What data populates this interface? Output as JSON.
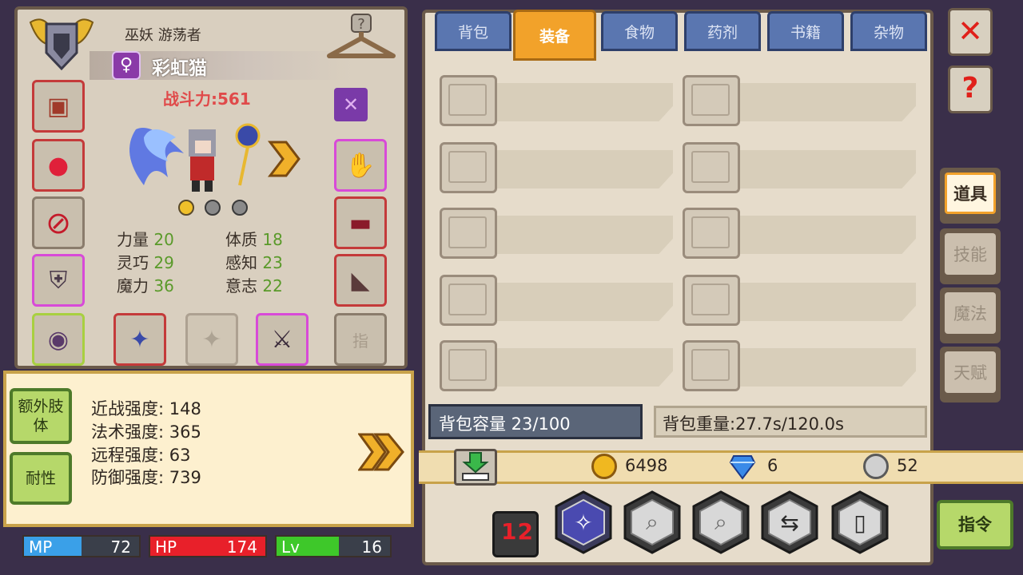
{
  "character": {
    "class_line": "巫妖 游荡者",
    "name": "彩虹猫",
    "gender_symbol": "♀",
    "power": "战斗力:561",
    "stats": [
      {
        "label": "力量",
        "value": "20"
      },
      {
        "label": "体质",
        "value": "18"
      },
      {
        "label": "灵巧",
        "value": "29"
      },
      {
        "label": "感知",
        "value": "23"
      },
      {
        "label": "魔力",
        "value": "36"
      },
      {
        "label": "意志",
        "value": "22"
      }
    ],
    "finger_slot_label": "指"
  },
  "info_panel": {
    "btn_extra_limbs": "额外肢体",
    "btn_resistance": "耐性",
    "lines": [
      "近战强度: 148",
      "法术强度: 365",
      "远程强度: 63",
      "防御强度: 739"
    ]
  },
  "bars": {
    "mp_label": "MP",
    "mp": "72",
    "hp_label": "HP",
    "hp": "174",
    "lv_label": "Lv",
    "lv": "16",
    "mp_fill": 0.5,
    "hp_fill": 1.0,
    "lv_fill": 0.55
  },
  "tabs": [
    "背包",
    "装备",
    "食物",
    "药剂",
    "书籍",
    "杂物"
  ],
  "active_tab": "装备",
  "inventory": {
    "capacity": "背包容量 23/100",
    "weight": "背包重量:27.7s/120.0s"
  },
  "currency": {
    "gold": "6498",
    "gems": "6",
    "silver": "52"
  },
  "side_tabs": [
    "道具",
    "技能",
    "魔法",
    "天赋"
  ],
  "active_side_tab": "道具",
  "command_label": "指令",
  "page_indicator": "12",
  "colors": {
    "active_tab": "#f2a22a",
    "tab": "#5a76b0",
    "mp": "#3aa0e8",
    "hp": "#e8202a",
    "lv": "#3ec82a",
    "panel": "#d9cfbf"
  }
}
